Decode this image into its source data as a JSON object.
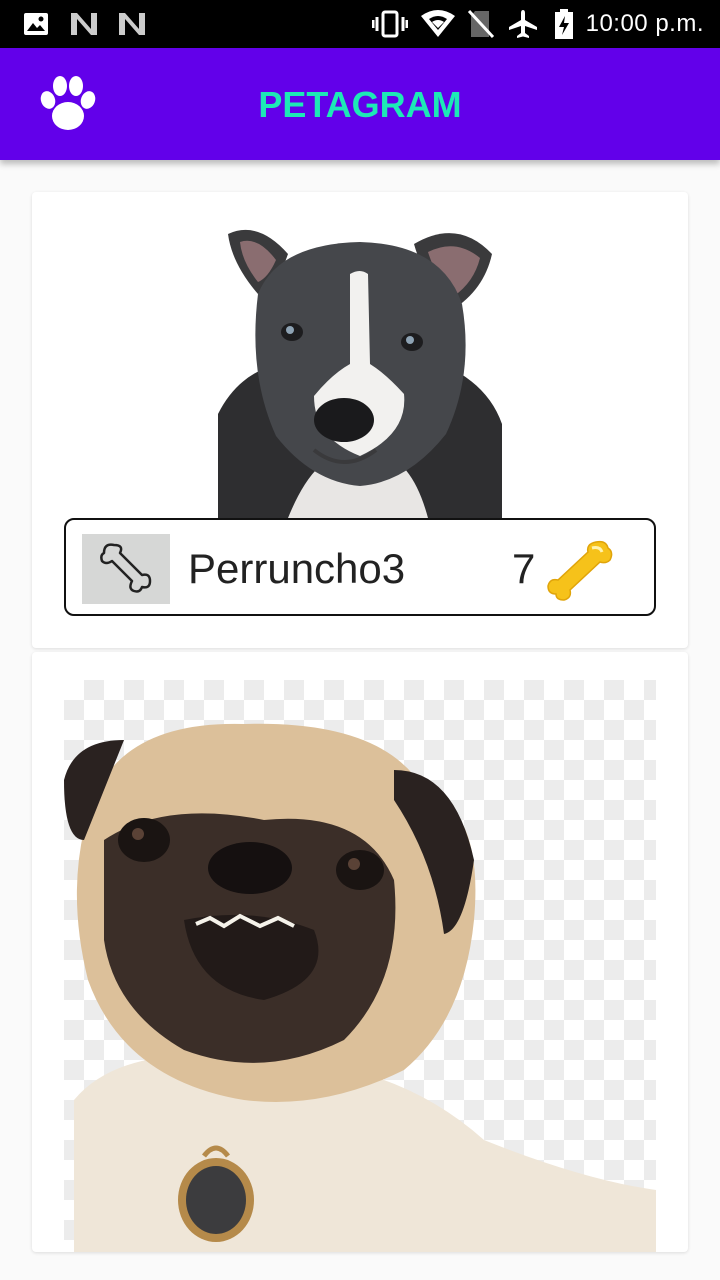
{
  "status_bar": {
    "time": "10:00 p.m.",
    "icons": [
      "image-icon",
      "n-notification-icon",
      "n-notification-icon",
      "vibrate-icon",
      "wifi-icon",
      "no-sim-icon",
      "airplane-mode-icon",
      "battery-charging-icon"
    ]
  },
  "app_bar": {
    "title": "PETAGRAM",
    "logo_icon": "paw-icon",
    "background_color": "#6200ea",
    "title_color": "#1de9b6"
  },
  "pets": [
    {
      "photo": "pitbull-puppy-photo",
      "name": "Perruncho3",
      "rating": "7",
      "like_icon": "bone-outline-icon",
      "rating_icon": "gold-bone-icon"
    },
    {
      "photo": "pug-photo"
    }
  ]
}
